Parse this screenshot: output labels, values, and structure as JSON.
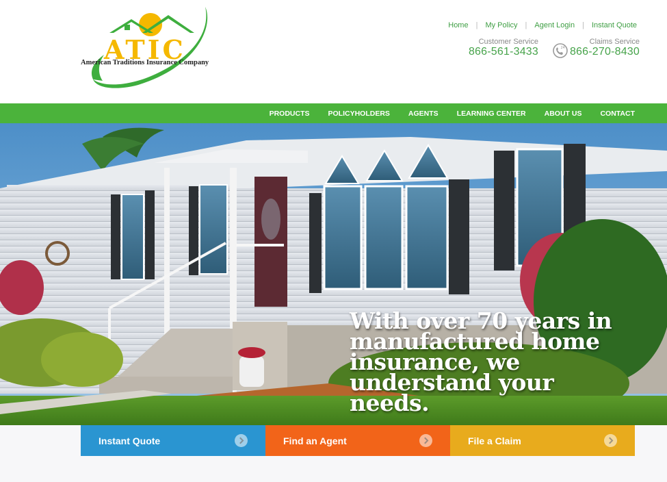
{
  "logo": {
    "word": "ATIC",
    "company": "American Traditions Insurance Company"
  },
  "top_links": [
    "Home",
    "My Policy",
    "Agent Login",
    "Instant Quote"
  ],
  "customer_service": {
    "label": "Customer Service",
    "phone": "866-561-3433"
  },
  "claims_service": {
    "label": "Claims Service",
    "phone": "866-270-8430",
    "icon": "24-hour-phone-icon"
  },
  "nav": [
    "PRODUCTS",
    "POLICYHOLDERS",
    "AGENTS",
    "LEARNING CENTER",
    "ABOUT US",
    "CONTACT"
  ],
  "hero": {
    "headline_lines": [
      "With over 70 years in",
      "manufactured home",
      "insurance, we",
      "understand your",
      "needs."
    ]
  },
  "cta": {
    "quote": "Instant Quote",
    "agent": "Find an Agent",
    "claim": "File a Claim"
  },
  "colors": {
    "brand_green": "#4bb33b",
    "quote_blue": "#2a95d1",
    "agent_orange": "#f26419",
    "claim_gold": "#e8ab1d",
    "logo_yellow": "#f5b800"
  }
}
